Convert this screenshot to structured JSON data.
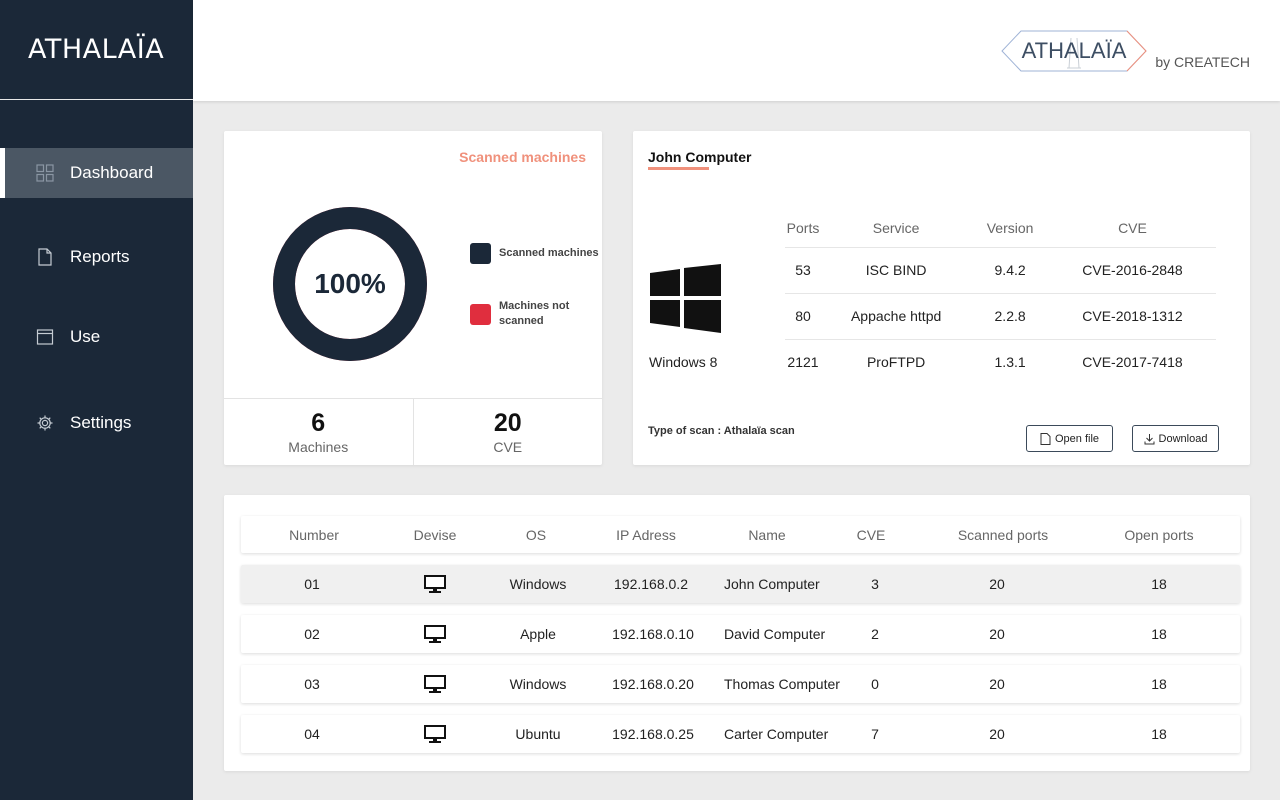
{
  "brand": {
    "name": "ATHALAÏA"
  },
  "header": {
    "logo_text": "ATHALAÏA",
    "logo_by": "by CREATECH"
  },
  "sidebar": {
    "items": [
      {
        "label": "Dashboard",
        "icon": "dashboard-grid-icon",
        "active": true
      },
      {
        "label": "Reports",
        "icon": "document-icon",
        "active": false
      },
      {
        "label": "Use",
        "icon": "window-icon",
        "active": false
      },
      {
        "label": "Settings",
        "icon": "gear-icon",
        "active": false
      }
    ]
  },
  "scan_summary": {
    "title": "Scanned machines",
    "percent_label": "100%",
    "scanned_fraction": 1.0,
    "legend": [
      {
        "label": "Scanned machines",
        "color": "#1b2838"
      },
      {
        "label": "Machines not scanned",
        "color": "#e02e3e"
      }
    ],
    "machines_count": "6",
    "machines_label": "Machines",
    "cve_count": "20",
    "cve_label": "CVE"
  },
  "detail": {
    "title": "John Computer",
    "os_icon": "windows-logo-icon",
    "os_name": "Windows 8",
    "columns": [
      "Ports",
      "Service",
      "Version",
      "CVE"
    ],
    "rows": [
      [
        "53",
        "ISC BIND",
        "9.4.2",
        "CVE-2016-2848"
      ],
      [
        "80",
        "Appache httpd",
        "2.2.8",
        "CVE-2018-1312"
      ],
      [
        "2121",
        "ProFTPD",
        "1.3.1",
        "CVE-2017-7418"
      ]
    ],
    "scan_type": "Type of scan : Athalaïa scan",
    "open_file_label": "Open file",
    "download_label": "Download"
  },
  "machines_table": {
    "columns": [
      "Number",
      "Devise",
      "OS",
      "IP Adress",
      "Name",
      "CVE",
      "Scanned ports",
      "Open ports"
    ],
    "rows": [
      {
        "number": "01",
        "device_icon": "desktop-monitor-icon",
        "os": "Windows",
        "ip": "192.168.0.2",
        "name": "John Computer",
        "cve": "3",
        "scanned_ports": "20",
        "open_ports": "18",
        "selected": true
      },
      {
        "number": "02",
        "device_icon": "desktop-monitor-icon",
        "os": "Apple",
        "ip": "192.168.0.10",
        "name": "David Computer",
        "cve": "2",
        "scanned_ports": "20",
        "open_ports": "18",
        "selected": false
      },
      {
        "number": "03",
        "device_icon": "desktop-monitor-icon",
        "os": "Windows",
        "ip": "192.168.0.20",
        "name": "Thomas Computer",
        "cve": "0",
        "scanned_ports": "20",
        "open_ports": "18",
        "selected": false
      },
      {
        "number": "04",
        "device_icon": "desktop-monitor-icon",
        "os": "Ubuntu",
        "ip": "192.168.0.25",
        "name": "Carter Computer",
        "cve": "7",
        "scanned_ports": "20",
        "open_ports": "18",
        "selected": false
      }
    ]
  }
}
